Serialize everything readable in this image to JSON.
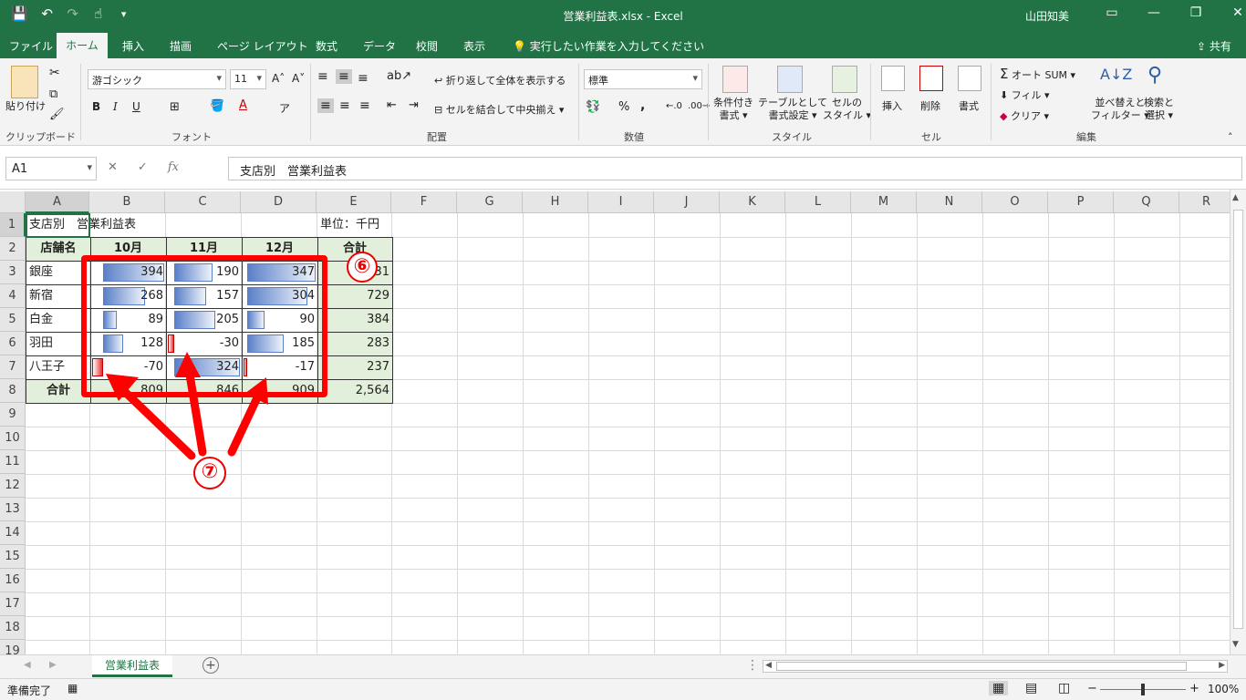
{
  "titlebar": {
    "quick_access": {
      "save": "save-icon",
      "undo": "↶",
      "redo": "↷",
      "touch": "touch-mode-icon"
    },
    "document_title": "営業利益表.xlsx  -  Excel",
    "user": "山田知美",
    "window_buttons": [
      "▭",
      "—",
      "❐",
      "✕"
    ]
  },
  "ribbon_tabs": [
    "ファイル",
    "ホーム",
    "挿入",
    "描画",
    "ページ レイアウト",
    "数式",
    "データ",
    "校閲",
    "表示"
  ],
  "tell_me": "実行したい作業を入力してください",
  "share": "共有",
  "ribbon": {
    "clipboard": {
      "label": "クリップボード",
      "paste": "貼り付け"
    },
    "font": {
      "label": "フォント",
      "name": "游ゴシック",
      "size": "11",
      "bold": "B",
      "italic": "I",
      "underline": "U"
    },
    "alignment": {
      "label": "配置",
      "wrap": "折り返して全体を表示する",
      "merge": "セルを結合して中央揃え"
    },
    "number": {
      "label": "数値",
      "format": "標準",
      "percent": "%",
      "comma": ","
    },
    "styles": {
      "label": "スタイル",
      "conditional": [
        "条件付き",
        "書式"
      ],
      "table": [
        "テーブルとして",
        "書式設定"
      ],
      "cell_styles": [
        "セルの",
        "スタイル"
      ]
    },
    "cells": {
      "label": "セル",
      "insert": "挿入",
      "delete": "削除",
      "format": "書式"
    },
    "editing": {
      "label": "編集",
      "autosum": "オート SUM",
      "fill": "フィル",
      "clear": "クリア",
      "sort": [
        "並べ替えと",
        "フィルター"
      ],
      "find": [
        "検索と",
        "選択"
      ]
    }
  },
  "formula_bar": {
    "name_box": "A1",
    "fx": "fx",
    "cancel": "✕",
    "confirm": "✓",
    "formula": "支店別　営業利益表"
  },
  "columns": [
    "A",
    "B",
    "C",
    "D",
    "E",
    "F",
    "G",
    "H",
    "I",
    "J",
    "K",
    "L",
    "M",
    "N",
    "O",
    "P",
    "Q",
    "R"
  ],
  "rows": [
    "1",
    "2",
    "3",
    "4",
    "5",
    "6",
    "7",
    "8",
    "9",
    "10",
    "11",
    "12",
    "13",
    "14",
    "15",
    "16",
    "17",
    "18",
    "19"
  ],
  "sheet": {
    "title": "支店別　営業利益表",
    "unit": "単位：千円",
    "headers": [
      "店舗名",
      "10月",
      "11月",
      "12月",
      "合計"
    ],
    "branches": [
      "銀座",
      "新宿",
      "白金",
      "羽田",
      "八王子"
    ],
    "b_values": [
      394,
      268,
      89,
      128,
      -70
    ],
    "c_values": [
      190,
      157,
      205,
      -30,
      324
    ],
    "d_values": [
      347,
      304,
      90,
      185,
      -17
    ],
    "totals": [
      "931",
      "729",
      "384",
      "283",
      "237"
    ],
    "sum_label": "合計",
    "sum_row": [
      "809",
      "846",
      "909",
      "2,564"
    ]
  },
  "annotations": {
    "six": "⑥",
    "seven": "⑦"
  },
  "sheet_tabs": {
    "active": "営業利益表",
    "add": "+"
  },
  "status": {
    "ready": "準備完了",
    "zoom": "100%"
  }
}
